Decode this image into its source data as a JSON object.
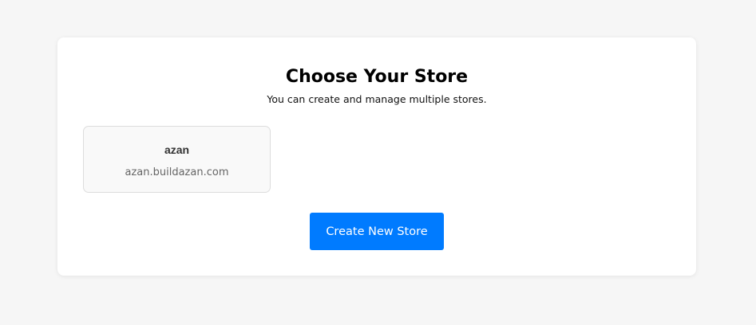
{
  "page": {
    "title": "Choose Your Store",
    "subtitle": "You can create and manage multiple stores."
  },
  "stores": [
    {
      "name": "azan",
      "domain": "azan.buildazan.com"
    }
  ],
  "actions": {
    "create_label": "Create New Store"
  },
  "colors": {
    "background": "#f6f6f6",
    "card": "#ffffff",
    "primary": "#007bff",
    "store_card_bg": "#f9f9f9",
    "store_card_border": "#dddddd"
  }
}
